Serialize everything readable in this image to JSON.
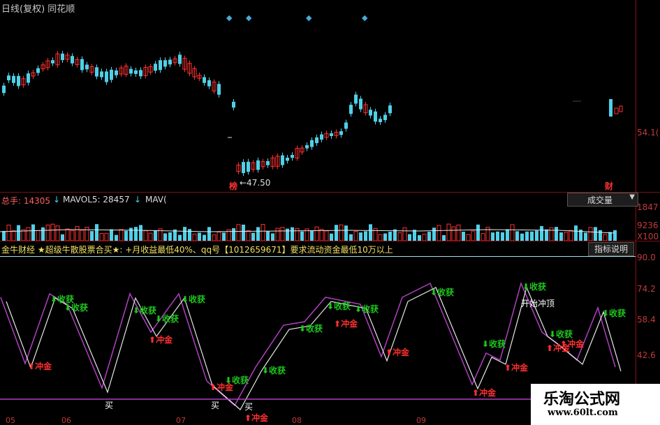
{
  "header": {
    "title": "日线(复权)  同花顺"
  },
  "price_panel": {
    "right_label": "54.1(",
    "min_label": "←47.50",
    "left_tag": "榜",
    "right_tag": "财"
  },
  "volume_panel": {
    "label": "总手: 14305",
    "mavol5": "MAVOL5: 28457",
    "mav10": "MAV(",
    "dropdown": "成交量",
    "right_labels": [
      "1847",
      "9236",
      "X100"
    ]
  },
  "indicator_panel": {
    "header_text": "金牛财经 ★超级牛散股票合买★: +月收益最低40%、qq号【1012659671】要求流动资金最低10万以上",
    "help_button": "指标说明",
    "right_labels": [
      "90.0",
      "74.2",
      "58.4",
      "42.6"
    ],
    "annotation": "开始冲顶",
    "sell_label": "收获",
    "buy_label": "冲金",
    "mai_label": "买"
  },
  "date_labels": [
    "05",
    "06",
    "07",
    "08",
    "09"
  ],
  "watermark": {
    "title": "乐淘公式网",
    "url": "www.60lt.com"
  },
  "colors": {
    "up": "#ff3030",
    "down": "#50d0e8",
    "magenta": "#b040c0",
    "white_line": "#e8e8e8",
    "axis": "#8a1010"
  }
}
